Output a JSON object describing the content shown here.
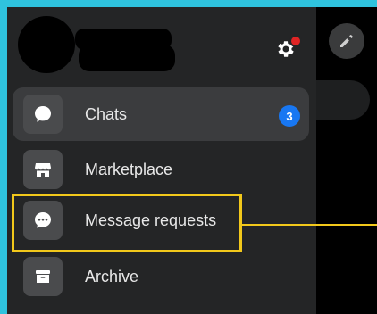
{
  "menu": {
    "items": [
      {
        "label": "Chats",
        "icon": "chat-bubble-icon",
        "badge": "3"
      },
      {
        "label": "Marketplace",
        "icon": "storefront-icon"
      },
      {
        "label": "Message requests",
        "icon": "chat-dots-icon"
      },
      {
        "label": "Archive",
        "icon": "archive-box-icon"
      }
    ]
  },
  "colors": {
    "background": "#2fc3de",
    "drawer": "#242526",
    "accent_badge": "#1877f2",
    "highlight": "#f2c81b",
    "notification_dot": "#e02424"
  }
}
